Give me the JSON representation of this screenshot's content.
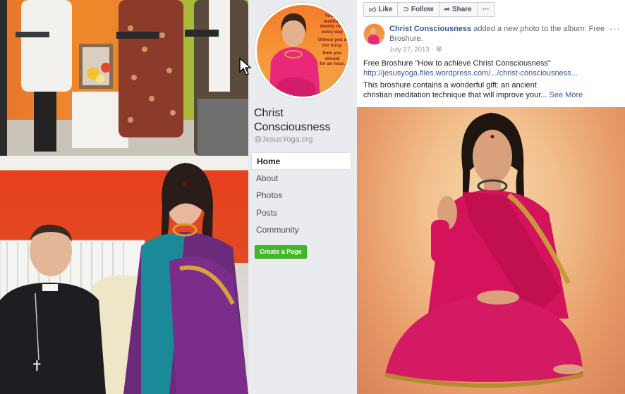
{
  "colors": {
    "fb_link": "#385898",
    "create_green": "#42b72a",
    "sidebar_bg": "#e9ebee"
  },
  "page": {
    "name": "Christ Consciousness",
    "handle": "@JesusYoga.org",
    "nav": [
      {
        "label": "Home",
        "active": true
      },
      {
        "label": "About"
      },
      {
        "label": "Photos"
      },
      {
        "label": "Posts"
      },
      {
        "label": "Community"
      }
    ],
    "create_button": "Create a Page"
  },
  "actions": {
    "like": "Like",
    "follow": "Follow",
    "share": "Share",
    "more": "···",
    "like_icon": "thumbs-up-icon",
    "follow_icon": "rss-icon",
    "share_icon": "share-arrow-icon"
  },
  "post": {
    "author": "Christ Consciousness",
    "headline_rest": " added a new photo to the album: Free Broshure.",
    "date": "July 27, 2013 · ",
    "privacy_icon": "globe-icon",
    "text_line1": "Free Broshure \"How to achieve Christ Consciousness\"",
    "link": "http://jesusyoga.files.wordpress.com/.../christ-consciousness...",
    "text_line2": "This broshure contains a wonderful gift: an ancient",
    "text_line3": "christian meditation technique that will improve your... ",
    "see_more": "See More"
  },
  "profile_badge_text": [
    "You sh",
    "meditati",
    "twenty min",
    "every day",
    "Unless you a",
    "too busy,",
    "then you should",
    "for an hour."
  ]
}
